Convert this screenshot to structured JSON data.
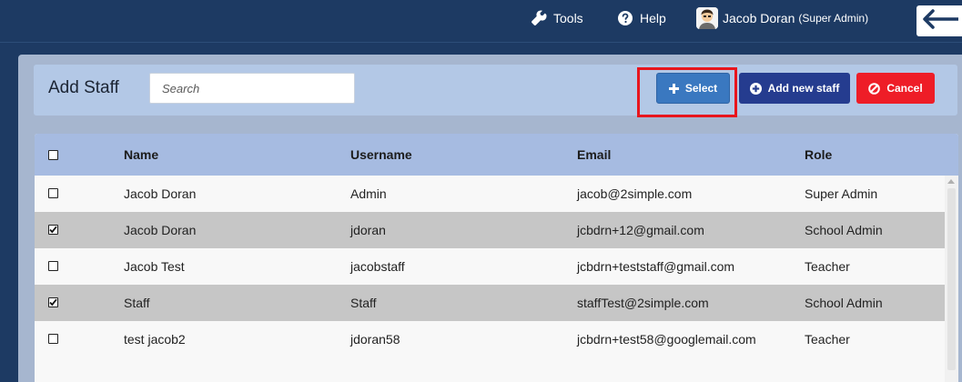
{
  "topbar": {
    "tools_label": "Tools",
    "help_label": "Help",
    "user_name": "Jacob Doran",
    "user_role": "(Super Admin)",
    "icons": {
      "tools": "wrench-icon",
      "help": "question-circle-icon",
      "back": "arrow-left-icon"
    }
  },
  "header": {
    "title": "Add Staff",
    "search_placeholder": "Search",
    "select_label": "Select",
    "add_label": "Add new staff",
    "cancel_label": "Cancel"
  },
  "table": {
    "columns": [
      "Name",
      "Username",
      "Email",
      "Role"
    ],
    "rows": [
      {
        "checked": false,
        "name": "Jacob Doran",
        "username": "Admin",
        "email": "jacob@2simple.com",
        "role": "Super Admin"
      },
      {
        "checked": true,
        "name": "Jacob Doran",
        "username": "jdoran",
        "email": "jcbdrn+12@gmail.com",
        "role": "School Admin"
      },
      {
        "checked": false,
        "name": "Jacob Test",
        "username": "jacobstaff",
        "email": "jcbdrn+teststaff@gmail.com",
        "role": "Teacher"
      },
      {
        "checked": true,
        "name": "Staff",
        "username": "Staff",
        "email": "staffTest@2simple.com",
        "role": "School Admin"
      },
      {
        "checked": false,
        "name": "test jacob2",
        "username": "jdoran58",
        "email": "jcbdrn+test58@googlemail.com",
        "role": "Teacher"
      }
    ]
  },
  "colors": {
    "topbar": "#1d3a63",
    "select_button": "#3a78c0",
    "add_button": "#253c8f",
    "cancel_button": "#ee1d27",
    "highlight_box": "#e8151d",
    "table_header": "#a6bbe1",
    "selected_row": "#c6c6c6"
  }
}
